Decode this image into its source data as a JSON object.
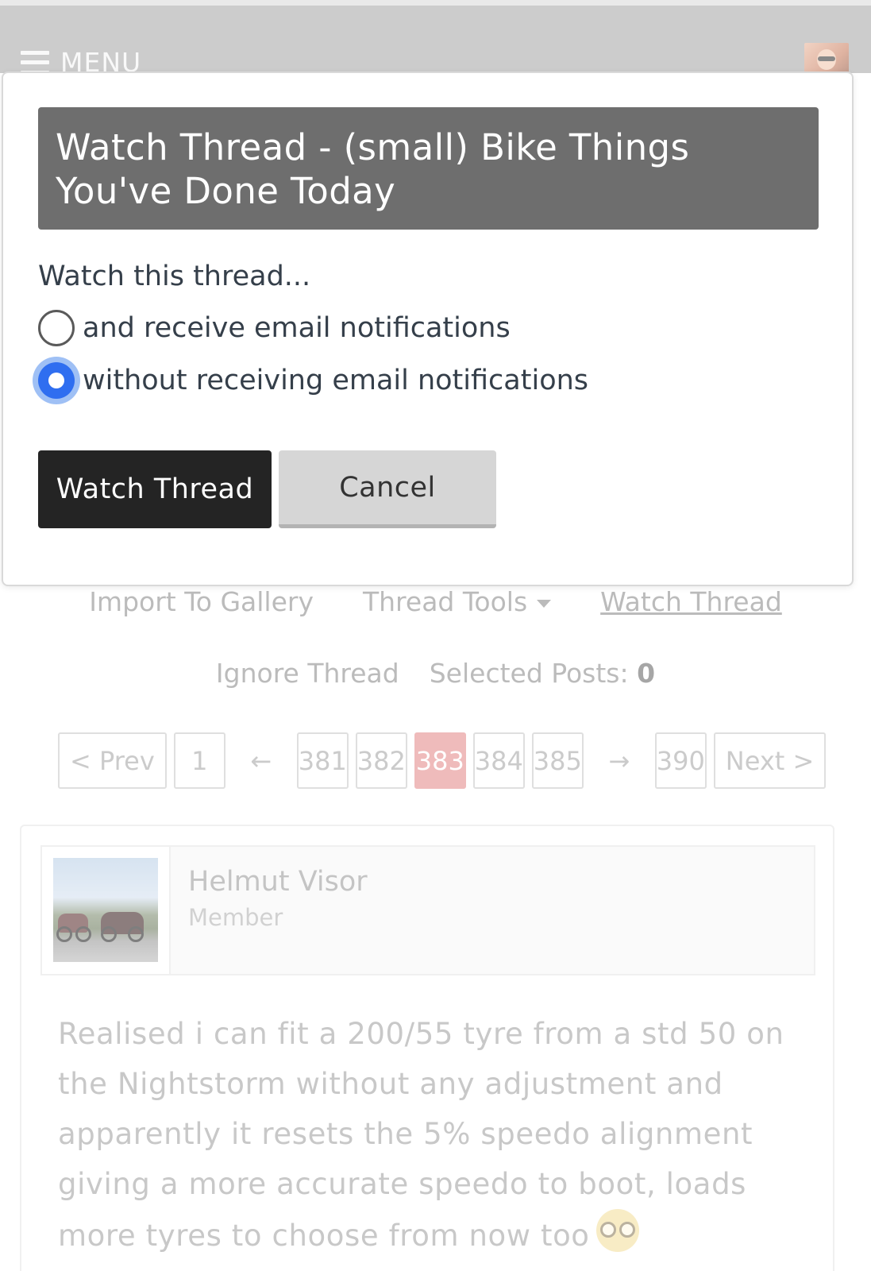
{
  "header": {
    "menu_label": "MENU",
    "menu_icon": "hamburger-icon",
    "avatar": "user-avatar"
  },
  "overlay": {
    "title": "Watch Thread - (small) Bike Things You've Done Today",
    "watch_label": "Watch this thread...",
    "options": [
      {
        "label": "and receive email notifications",
        "selected": false
      },
      {
        "label": "without receiving email notifications",
        "selected": true
      }
    ],
    "confirm_button": "Watch Thread",
    "cancel_button": "Cancel"
  },
  "thread_tools": {
    "import": "Import To Gallery",
    "tools": "Thread Tools",
    "watch": "Watch Thread",
    "ignore": "Ignore Thread",
    "selected_posts_label": "Selected Posts:",
    "selected_posts_count": "0"
  },
  "pagination": {
    "prev": "< Prev",
    "first": "1",
    "left_arrow": "←",
    "pages": [
      "381",
      "382",
      "383",
      "384",
      "385"
    ],
    "current": "383",
    "right_arrow": "→",
    "last": "390",
    "next": "Next >"
  },
  "post": {
    "author_name": "Helmut Visor",
    "author_title": "Member",
    "body": "Realised i can fit a 200/55 tyre from a std 50 on the Nightstorm without any adjustment and apparently it resets the 5% speedo alignment giving a more accurate speedo to boot, loads more tyres to choose from now too",
    "emoji": "nerd-face-emoji"
  },
  "colors": {
    "header_bg": "#a8a8a8",
    "overlay_title_bg": "#6e6e6e",
    "primary_button": "#242424",
    "radio_selected": "#2f6ef0",
    "current_page": "#e48b8b"
  }
}
